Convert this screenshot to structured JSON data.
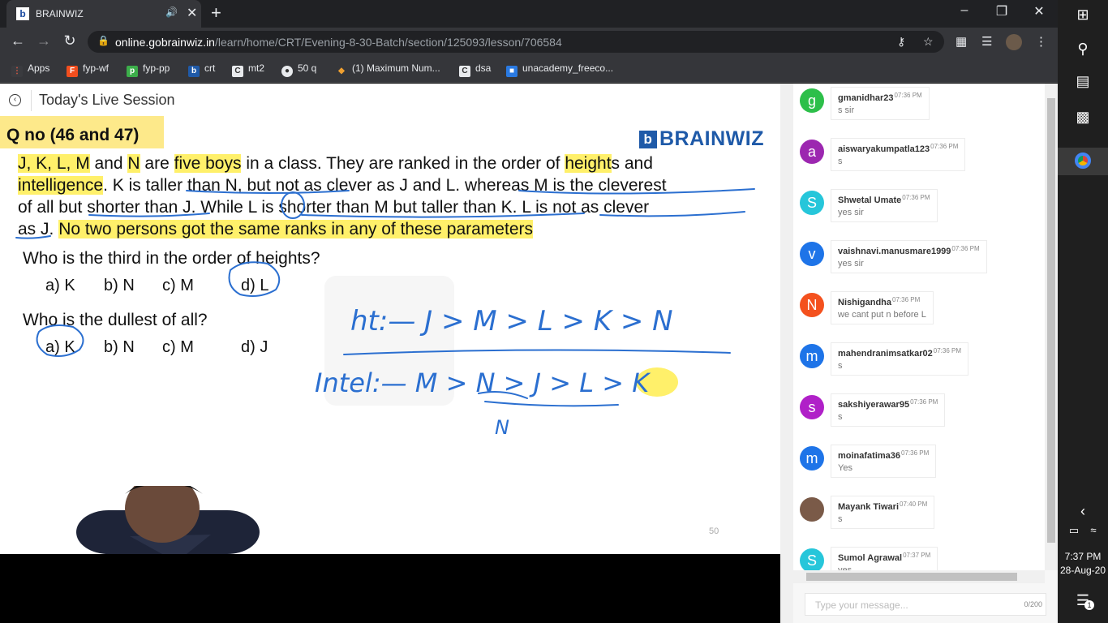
{
  "browser": {
    "tab_title": "BRAINWIZ",
    "favicon_letter": "b",
    "url_host": "online.gobrainwiz.in",
    "url_path": "/learn/home/CRT/Evening-8-30-Batch/section/125093/lesson/706584",
    "bookmarks": [
      "Apps",
      "fyp-wf",
      "fyp-pp",
      "crt",
      "mt2",
      "50 q",
      "(1) Maximum Num...",
      "dsa",
      "unacademy_freeco..."
    ],
    "icons": [
      "back-arrow",
      "forward-arrow",
      "reload",
      "lock",
      "key",
      "star",
      "puzzle",
      "media-queue",
      "more"
    ]
  },
  "page": {
    "title": "Today's Live Session"
  },
  "slide": {
    "q_label": "Q no (46 and 47)",
    "logo": "BRAINWIZ",
    "logo_mark": "b",
    "para": {
      "l1a": "J, K, L, M",
      "l1b": " and ",
      "l1c": "N",
      "l1d": " are ",
      "l1e": "five boys",
      "l1f": " in a class. They are ranked in the order of ",
      "l1g": "height",
      "l1h": "s and",
      "l2a": "intelligence",
      "l2b": ". K is taller than N, but not as clever as J and L. whereas M is the cleverest",
      "l3": "of all but shorter than J. While L is shorter than M but taller than K. L is not as clever",
      "l4a": "as J. ",
      "l4b": "No two persons got the same ranks in any of these parameters"
    },
    "q1": "Who is the third in the order of heights?",
    "q1_options": [
      "a) K",
      "b) N",
      "c) M",
      "d) L"
    ],
    "q2": "Who is the dullest of all?",
    "q2_options": [
      "a) K",
      "b) N",
      "c) M",
      "d) J"
    ],
    "ink_ht": "ht:— J > M > L > K > N",
    "ink_intel": "Intel:— M > N > J > L > K",
    "ink_n": "N",
    "page_number": "50"
  },
  "chat": {
    "messages": [
      {
        "initial": "g",
        "color": "#2dbf4a",
        "user": "gmanidhar23",
        "time": "07:36 PM",
        "text": "s sir"
      },
      {
        "initial": "a",
        "color": "#9c27b0",
        "user": "aiswaryakumpatla123",
        "time": "07:36 PM",
        "text": "s"
      },
      {
        "initial": "S",
        "color": "#26c6da",
        "user": "Shwetal Umate",
        "time": "07:36 PM",
        "text": "yes sir"
      },
      {
        "initial": "v",
        "color": "#1e74e8",
        "user": "vaishnavi.manusmare1999",
        "time": "07:36 PM",
        "text": "yes sir"
      },
      {
        "initial": "N",
        "color": "#f4511e",
        "user": "Nishigandha",
        "time": "07:36 PM",
        "text": "we cant put n before L"
      },
      {
        "initial": "m",
        "color": "#1e74e8",
        "user": "mahendranimsatkar02",
        "time": "07:36 PM",
        "text": "s"
      },
      {
        "initial": "s",
        "color": "#b020c8",
        "user": "sakshiyerawar95",
        "time": "07:36 PM",
        "text": "s"
      },
      {
        "initial": "m",
        "color": "#1e74e8",
        "user": "moinafatima36",
        "time": "07:36 PM",
        "text": "Yes"
      },
      {
        "initial": "",
        "color": "#7a5a48",
        "user": "Mayank Tiwari",
        "time": "07:40 PM",
        "text": "s"
      },
      {
        "initial": "S",
        "color": "#26c6da",
        "user": "Sumol Agrawal",
        "time": "07:37 PM",
        "text": "yes"
      }
    ],
    "input_placeholder": "Type your message...",
    "char_count": "0/200"
  },
  "taskbar": {
    "time": "7:37 PM",
    "date": "28-Aug-20",
    "notification_count": "1"
  }
}
